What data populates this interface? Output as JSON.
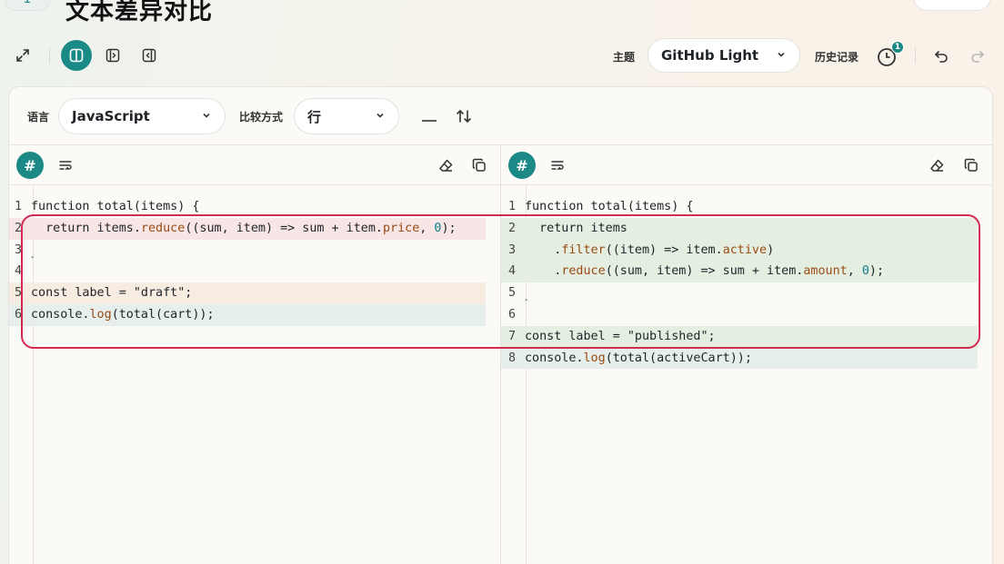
{
  "header": {
    "app_icon": "1",
    "title": "文本差异对比"
  },
  "toolbar": {
    "theme_label": "主题",
    "theme_value": "GitHub Light",
    "history_label": "历史记录",
    "history_badge": "1",
    "icons": [
      "expand-icon",
      "split-view-icon",
      "left-panel-icon",
      "right-panel-icon",
      "history-icon",
      "undo-icon",
      "redo-icon"
    ]
  },
  "controls": {
    "language_label": "语言",
    "language_value": "JavaScript",
    "compare_label": "比较方式",
    "compare_value": "行"
  },
  "left_pane": {
    "lines": [
      {
        "n": "1",
        "text": "function total(items) {"
      },
      {
        "n": "2",
        "text": "  return items.reduce((sum, item) => sum + item.price, 0);"
      },
      {
        "n": "3",
        "text": "}"
      },
      {
        "n": "4",
        "text": ""
      },
      {
        "n": "5",
        "text": "const label = \"draft\";"
      },
      {
        "n": "6",
        "text": "console.log(total(cart));"
      }
    ]
  },
  "right_pane": {
    "lines": [
      {
        "n": "1",
        "text": "function total(items) {"
      },
      {
        "n": "2",
        "text": "  return items"
      },
      {
        "n": "3",
        "text": "    .filter((item) => item.active)"
      },
      {
        "n": "4",
        "text": "    .reduce((sum, item) => sum + item.amount, 0);"
      },
      {
        "n": "5",
        "text": "}"
      },
      {
        "n": "6",
        "text": ""
      },
      {
        "n": "7",
        "text": "const label = \"published\";"
      },
      {
        "n": "8",
        "text": "console.log(total(activeCart));"
      }
    ]
  },
  "colors": {
    "accent": "#1b8a86",
    "removed_bg": "#f8e6e6",
    "added_bg": "#e4efe2",
    "highlight": "#d32b52"
  }
}
